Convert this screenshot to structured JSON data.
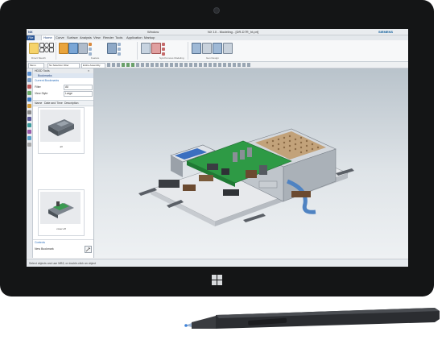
{
  "window": {
    "app_logo": "NX",
    "window_menu": "Window",
    "title": "NX 10 - Modeling - [DR-D7R_ht.prt]",
    "brand": "SIEMENS"
  },
  "menu_tabs": [
    "File",
    "Home",
    "Curve",
    "Surface",
    "Analysis",
    "View",
    "Render",
    "Tools",
    "Application",
    "Markup"
  ],
  "ribbon": {
    "groups": [
      "Direct Sketch",
      "Feature",
      "Synchronous Modeling",
      "Gen Design"
    ],
    "buttons": [
      "Sketch",
      "Extrude",
      "Hole",
      "Unite",
      "Edge Blend",
      "Chamfer",
      "Shell",
      "Draft",
      "Move Face",
      "Offset Region",
      "Replace Face",
      "Delete Face",
      "More"
    ]
  },
  "selection_bar": {
    "menu_label": "Menu",
    "filter_value": "No Selection Filter",
    "scope_value": "Entire Assembly"
  },
  "navigator": {
    "header": "HD3D Tools",
    "tab": "Bookmarks",
    "current_section": "Current Bookmarks",
    "filter_label": "Filter",
    "filter_value": "All",
    "view_style_label": "View Style",
    "view_style_value": "Large",
    "columns": [
      "Name",
      "Date and Time",
      "Description"
    ],
    "bookmarks": [
      {
        "caption": "all"
      },
      {
        "caption": "cover off"
      }
    ],
    "controls_section": "Controls",
    "new_bookmark_label": "New Bookmark"
  },
  "status_bar": {
    "message": "Select objects and use MB3, or double-click an object"
  },
  "icons": [
    "windows-logo-icon",
    "camera-icon",
    "stylus-pen-icon",
    "home-tab-icon"
  ],
  "colors": {
    "bezel": "#141516",
    "file_tab": "#2b5797",
    "viewport_top": "#b9c3cb",
    "pcb_green": "#2e9a45"
  }
}
